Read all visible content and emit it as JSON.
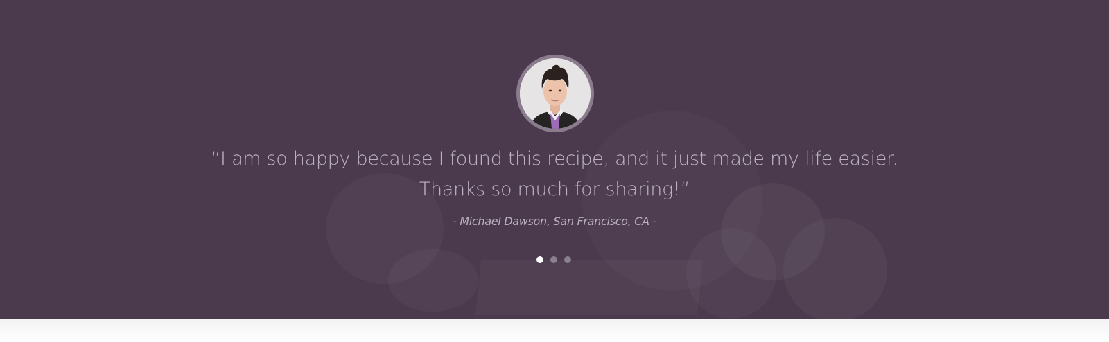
{
  "testimonial": {
    "quote_line1": "“I am so happy because I found this recipe, and it just made my life easier.",
    "quote_line2": "Thanks  so much for sharing!”",
    "author": "- Michael Dawson, San Francisco, CA -"
  },
  "slider": {
    "dot_count": 3,
    "active_index": 0
  },
  "colors": {
    "overlay": "#4b3a4d",
    "avatar_border": "#8a7c8d",
    "active_dot": "#ffffff"
  },
  "icons": {
    "avatar": "person-photo"
  }
}
